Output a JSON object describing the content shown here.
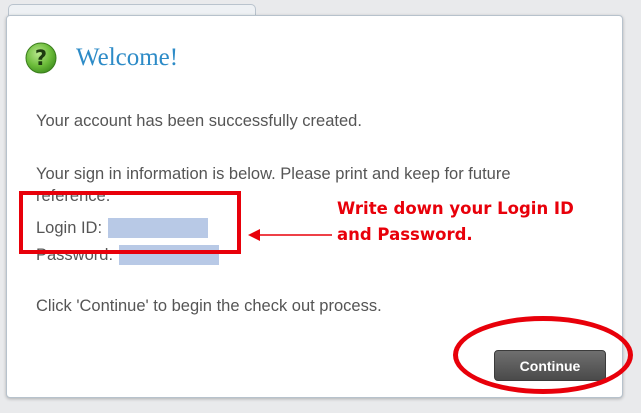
{
  "dialog": {
    "title": "Welcome!",
    "icon": "help-icon",
    "message": "Your account has been successfully created.",
    "info": "Your sign in information is below. Please print and keep for future reference.",
    "login_label": "Login ID:",
    "password_label": "Password:",
    "instruction": "Click 'Continue' to begin the check out process.",
    "continue_label": "Continue"
  },
  "annotation": {
    "line1": "Write down your Login ID",
    "line2": "and Password."
  },
  "colors": {
    "title": "#2d8bc7",
    "annotation_red": "#e8000a",
    "icon_green": "#6cbc3a",
    "redaction": "#b8c9e6"
  }
}
